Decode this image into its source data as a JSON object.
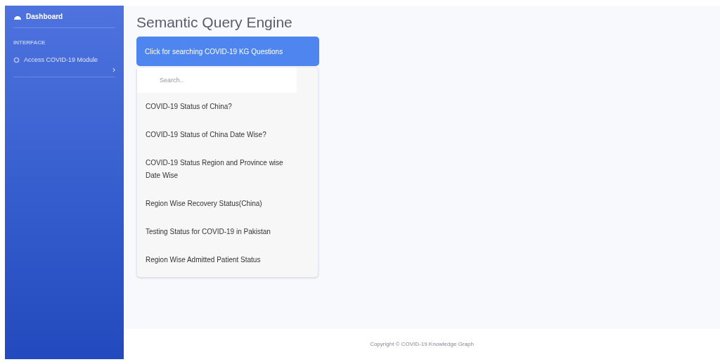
{
  "sidebar": {
    "brand": "Dashboard",
    "section": "INTERFACE",
    "items": [
      {
        "label": "Access COVID-19 Module",
        "chevron": "›"
      }
    ]
  },
  "page_title": "Semantic Query Engine",
  "dropdown": {
    "button": "Click for searching COVID-19 KG Questions",
    "search": {
      "placeholder": "Search.."
    },
    "items": [
      "COVID-19 Status of China?",
      "COVID-19 Status of China Date Wise?",
      "COVID-19 Status Region and Province wise Date Wise",
      "Region Wise Recovery Status(China)",
      "Testing Status for COVID-19 in Pakistan",
      "Region Wise Admitted Patient Status"
    ]
  },
  "footer": "Copyright © COVID-19 Knowledge Graph"
}
